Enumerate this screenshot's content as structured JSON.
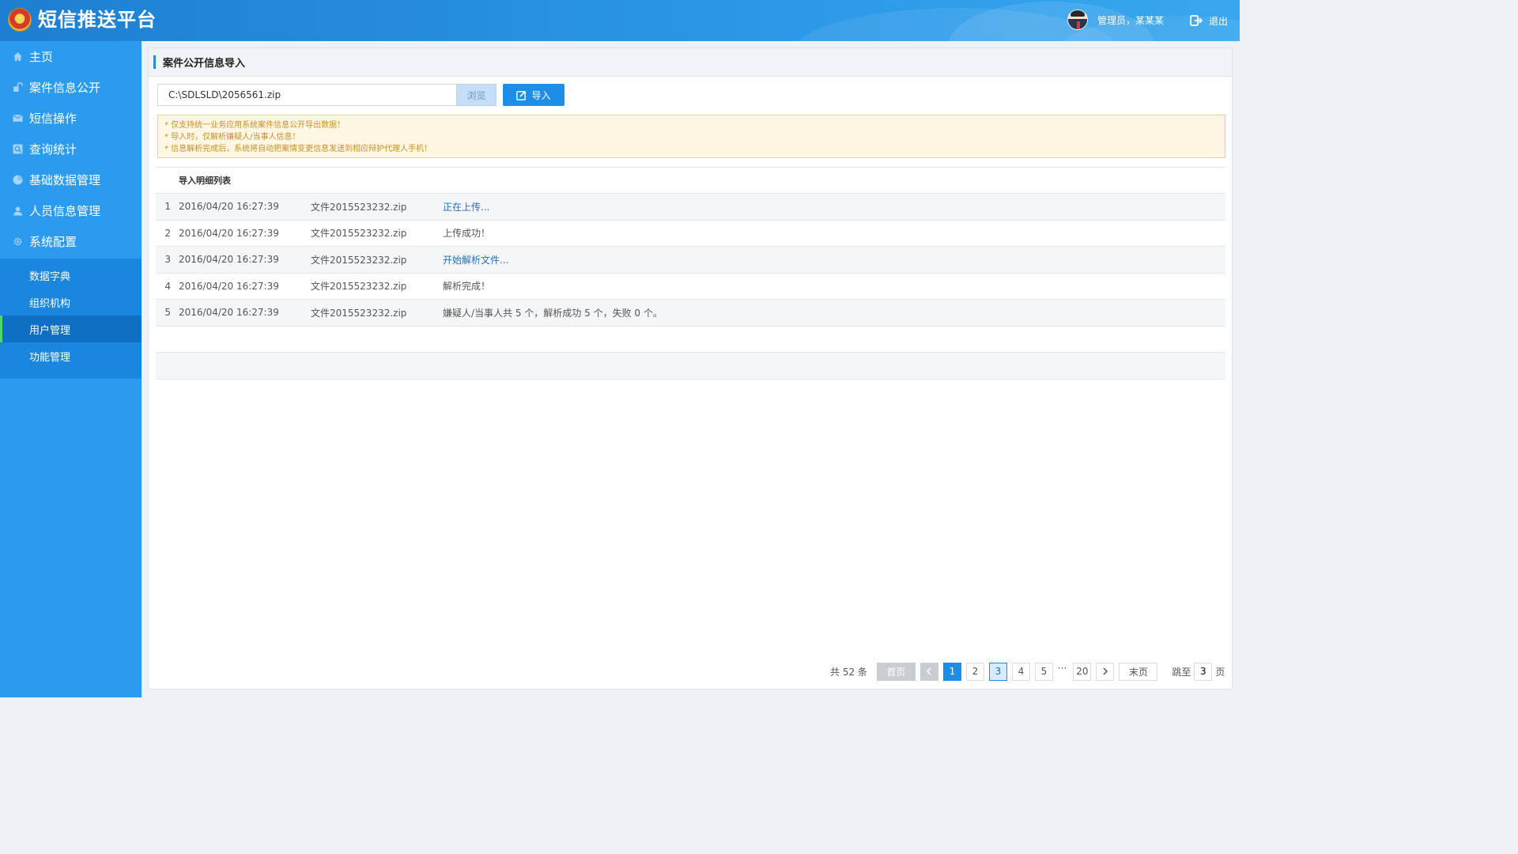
{
  "header": {
    "app_title": "短信推送平台",
    "user_label": "管理员，某某某",
    "logout_label": "退出"
  },
  "sidebar": {
    "items": [
      {
        "label": "主页",
        "icon": "home-icon"
      },
      {
        "label": "案件信息公开",
        "icon": "case-icon"
      },
      {
        "label": "短信操作",
        "icon": "envelope-icon"
      },
      {
        "label": "查询统计",
        "icon": "search-stats-icon"
      },
      {
        "label": "基础数据管理",
        "icon": "pie-chart-icon"
      },
      {
        "label": "人员信息管理",
        "icon": "person-icon"
      },
      {
        "label": "系统配置",
        "icon": "gear-icon"
      }
    ],
    "sub_items": [
      "数据字典",
      "组织机构",
      "用户管理",
      "功能管理"
    ],
    "active_sub": "用户管理"
  },
  "panel": {
    "title": "案件公开信息导入",
    "file_value": "C:\\SDLSLD\\2056561.zip",
    "browse_label": "浏览",
    "import_label": "导入",
    "notices": [
      "* 仅支持统一业务应用系统案件信息公开导出数据！",
      "* 导入时，仅解析嫌疑人/当事人信息！",
      "* 信息解析完成后，系统将自动把案情变更信息发送到相应辩护代理人手机！"
    ],
    "table_header": "导入明细列表",
    "rows": [
      {
        "idx": "1",
        "time": "2016/04/20  16:27:39",
        "file": "文件2015523232.zip",
        "status": "正在上传..."
      },
      {
        "idx": "2",
        "time": "2016/04/20  16:27:39",
        "file": "文件2015523232.zip",
        "status": "上传成功！"
      },
      {
        "idx": "3",
        "time": "2016/04/20  16:27:39",
        "file": "文件2015523232.zip",
        "status": "开始解析文件..."
      },
      {
        "idx": "4",
        "time": "2016/04/20  16:27:39",
        "file": "文件2015523232.zip",
        "status": "解析完成！"
      },
      {
        "idx": "5",
        "time": "2016/04/20  16:27:39",
        "file": "文件2015523232.zip",
        "status": "嫌疑人/当事人共 5 个，解析成功 5 个，失败 0 个。"
      }
    ]
  },
  "pagination": {
    "total": "共 52 条",
    "first": "首页",
    "pages": [
      "1",
      "2",
      "3",
      "4",
      "5"
    ],
    "ellipsis": "···",
    "last_page": "20",
    "last": "末页",
    "jump_label": "跳至",
    "jump_value": "3",
    "page_unit": "页"
  },
  "colors": {
    "header_blue": "#1e7fd1",
    "sidebar_blue": "#2b9bf0",
    "active_sub_bg": "#0f6fc3",
    "active_indicator": "#4cd964",
    "primary_button": "#1c8ee8",
    "notice_bg": "#fff7e4",
    "notice_text": "#c8902a",
    "link_blue": "#1f6fbf"
  }
}
